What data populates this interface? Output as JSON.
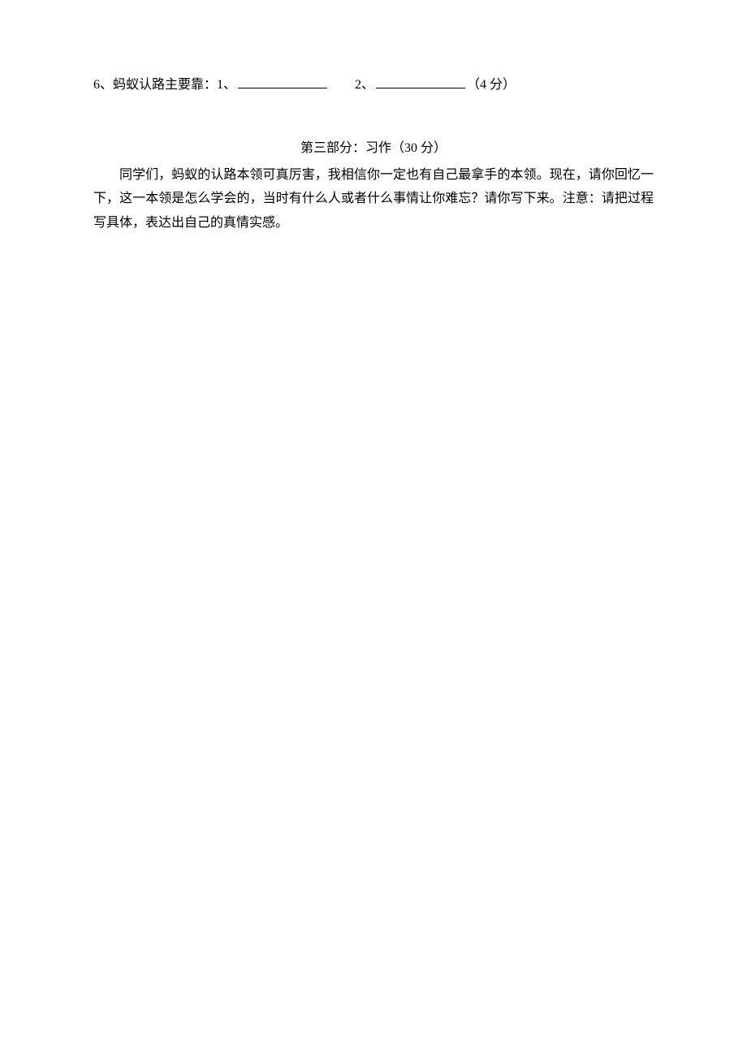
{
  "question6": {
    "prefix": "6、蚂蚁认路主要靠：1、",
    "middle": "　　2、",
    "suffix": "（4 分）"
  },
  "section3": {
    "header": "第三部分：习作（30 分）",
    "prompt": "同学们，蚂蚁的认路本领可真厉害，我相信你一定也有自己最拿手的本领。现在，请你回忆一下，这一本领是怎么学会的，当时有什么人或者什么事情让你难忘？请你写下来。注意：请把过程写具体，表达出自己的真情实感。"
  }
}
